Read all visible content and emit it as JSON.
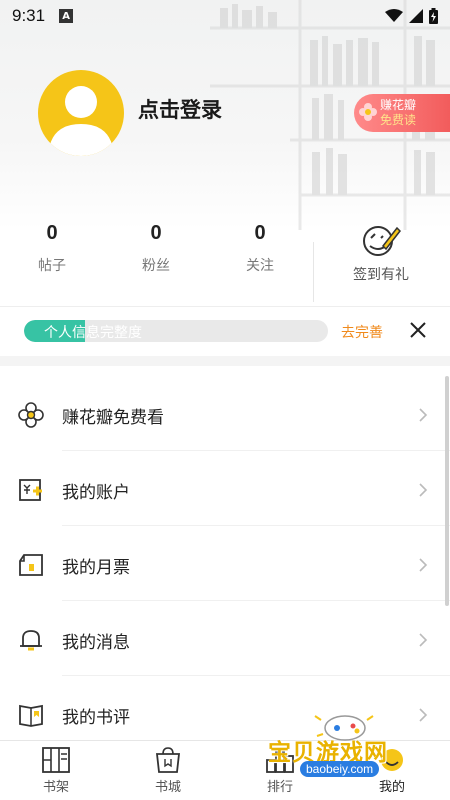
{
  "status_bar": {
    "time": "9:31",
    "notification_icon": "A"
  },
  "profile": {
    "login_prompt": "点击登录"
  },
  "promo": {
    "line1": "赚花瓣",
    "line2": "免费读"
  },
  "stats": [
    {
      "value": "0",
      "label": "帖子"
    },
    {
      "value": "0",
      "label": "粉丝"
    },
    {
      "value": "0",
      "label": "关注"
    }
  ],
  "checkin": {
    "label": "签到有礼"
  },
  "profile_completion": {
    "label": "个人信息完整度",
    "progress": 0.2,
    "action": "去完善"
  },
  "menu": [
    {
      "icon": "flower-icon",
      "label": "赚花瓣免费看"
    },
    {
      "icon": "account-icon",
      "label": "我的账户"
    },
    {
      "icon": "ticket-icon",
      "label": "我的月票"
    },
    {
      "icon": "bell-icon",
      "label": "我的消息"
    },
    {
      "icon": "book-review-icon",
      "label": "我的书评"
    }
  ],
  "tabs": [
    {
      "icon": "bookshelf-icon",
      "label": "书架"
    },
    {
      "icon": "bookstore-icon",
      "label": "书城"
    },
    {
      "icon": "ranking-icon",
      "label": "排行"
    },
    {
      "icon": "profile-icon",
      "label": "我的"
    }
  ],
  "watermark": {
    "text": "宝贝游戏网",
    "url": "baobeiy.com"
  },
  "colors": {
    "accent_yellow": "#f5c518",
    "progress_green": "#37c3a4",
    "action_orange": "#f08a1c",
    "promo_red": "#f25c5c"
  }
}
